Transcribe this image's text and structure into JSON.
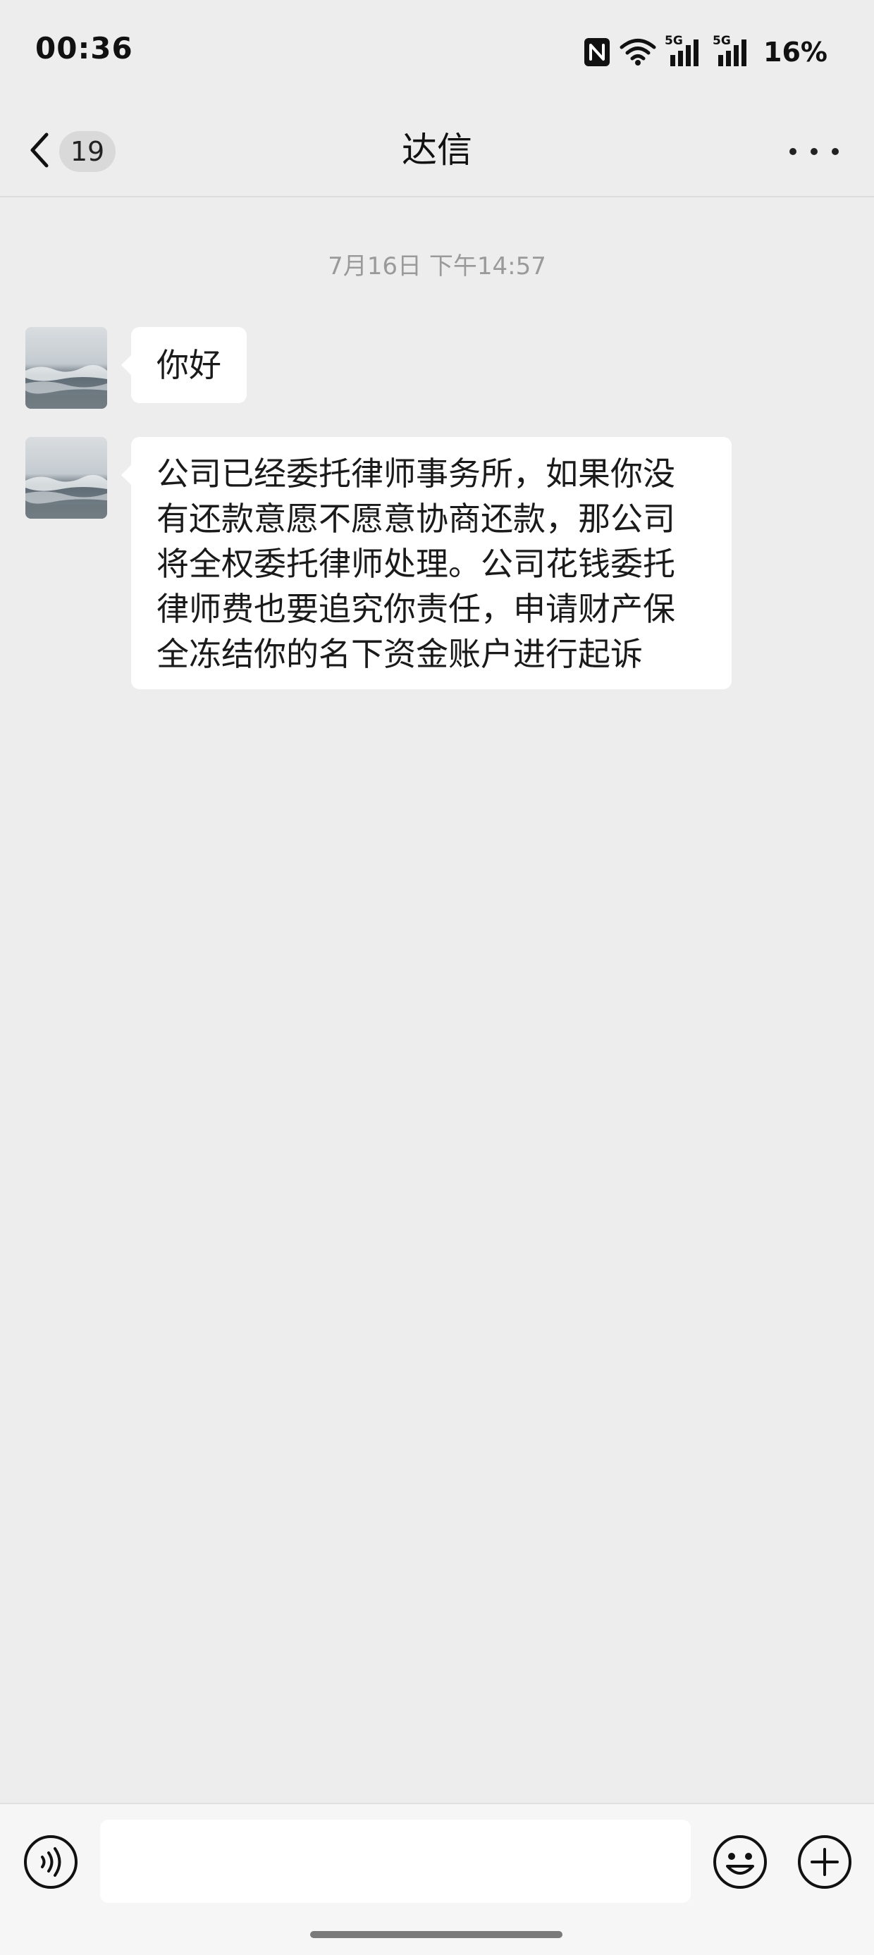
{
  "status_bar": {
    "time": "00:36",
    "network_1": "5G",
    "network_2": "5G",
    "battery": "16%",
    "icons": [
      "nfc-icon",
      "wifi-icon",
      "signal-5g-icon",
      "signal-5g-icon"
    ]
  },
  "nav": {
    "back_count": "19",
    "title": "达信",
    "icons": [
      "back-chevron-icon",
      "more-dots-icon"
    ]
  },
  "chat": {
    "timestamp": "7月16日 下午14:57",
    "messages": [
      {
        "sender": "contact",
        "text": "你好"
      },
      {
        "sender": "contact",
        "lines": [
          "公司已经委托律师事务所，如果你没",
          "有还款意愿不愿意协商还款，那公司",
          "将全权委托律师处理。公司花钱委托",
          "律师费也要追究你责任，申请财产保",
          "全冻结你的名下资金账户进行起诉"
        ]
      }
    ]
  },
  "input_bar": {
    "placeholder": "",
    "icons": [
      "voice-icon",
      "emoji-icon",
      "plus-icon"
    ]
  },
  "colors": {
    "background": "#ededed",
    "bubble": "#ffffff",
    "input_bar": "#f6f6f6"
  }
}
